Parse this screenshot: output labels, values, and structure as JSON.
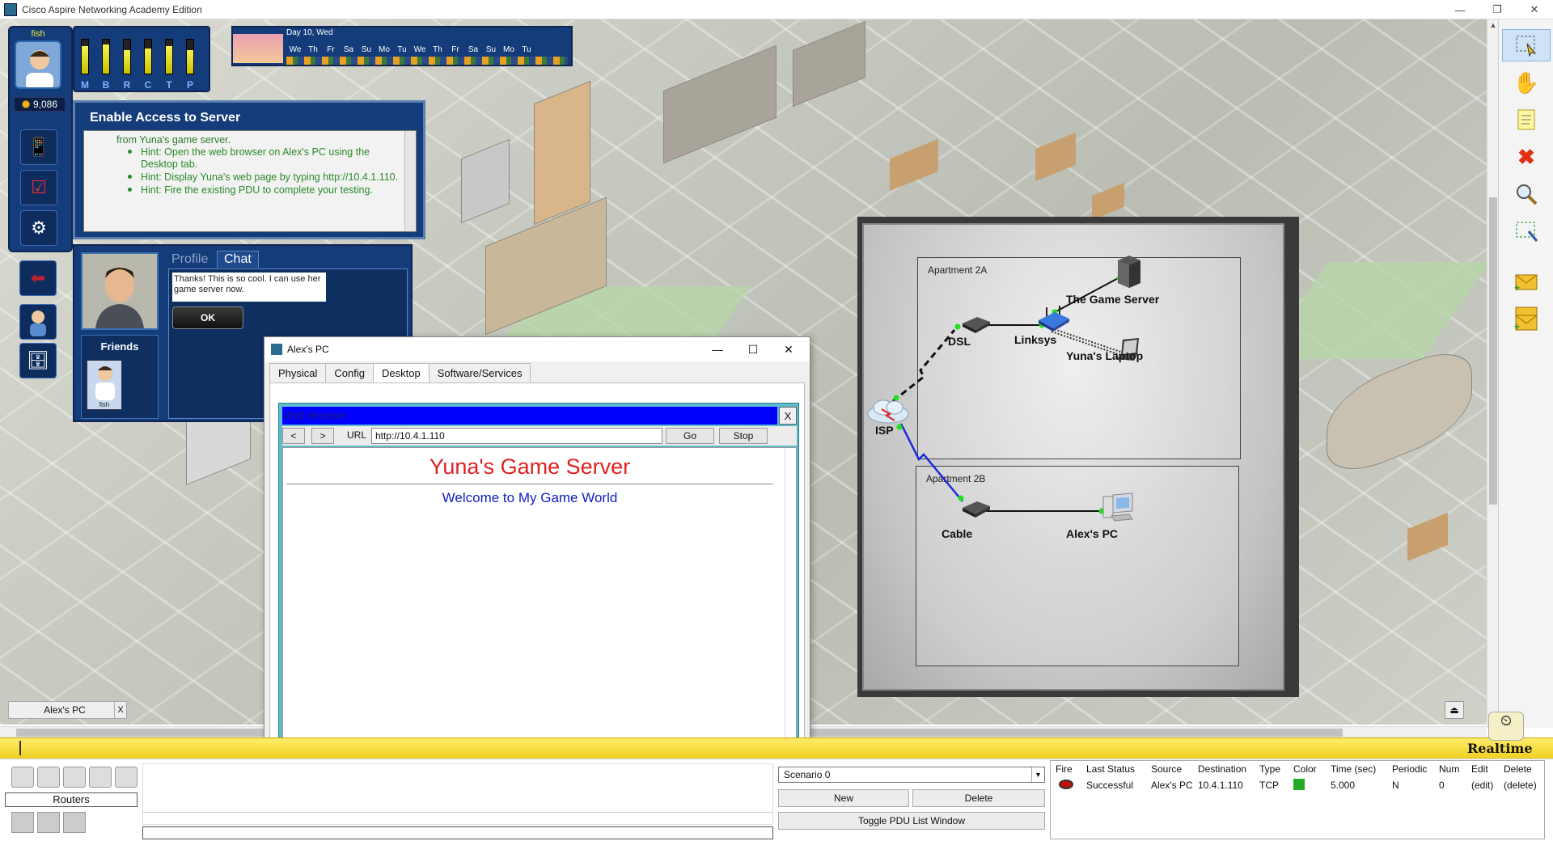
{
  "window": {
    "title": "Cisco Aspire Networking Academy Edition",
    "min": "—",
    "max": "❐",
    "close": "✕"
  },
  "player": {
    "name": "fish",
    "coins": "9,086",
    "meter_labels": [
      "M",
      "B",
      "R",
      "C",
      "T",
      "P"
    ],
    "meter_levels": [
      0.8,
      0.85,
      0.7,
      0.75,
      0.8,
      0.7
    ]
  },
  "calendar": {
    "day": "Day 10, Wed",
    "days": [
      "We",
      "Th",
      "Fr",
      "Sa",
      "Su",
      "Mo",
      "Tu",
      "We",
      "Th",
      "Fr",
      "Sa",
      "Su",
      "Mo",
      "Tu"
    ]
  },
  "task": {
    "title": "Enable Access to Server",
    "intro": "from Yuna's game server.",
    "hints": [
      "Hint: Open the web browser on Alex's PC using the Desktop tab.",
      "Hint: Display Yuna's web page by typing http://10.4.1.110.",
      "Hint: Fire the existing PDU to complete your testing."
    ]
  },
  "chat": {
    "tab_profile": "Profile",
    "tab_chat": "Chat",
    "message": "Thanks! This is so cool. I can use her game server now.",
    "ok": "OK",
    "friends_title": "Friends",
    "friend_name": "fish"
  },
  "network": {
    "apartment_a": "Apartment 2A",
    "apartment_b": "Apartment 2B",
    "devices": {
      "dsl": "DSL",
      "linksys": "Linksys",
      "game_server": "The Game Server",
      "laptop": "Yuna's Laptop",
      "isp": "ISP",
      "cable": "Cable",
      "alex_pc": "Alex's PC"
    }
  },
  "pc_window": {
    "title": "Alex's PC",
    "tabs": [
      "Physical",
      "Config",
      "Desktop",
      "Software/Services"
    ],
    "active_tab": "Desktop",
    "browser": {
      "title": "Web Browser",
      "close": "X",
      "back": "<",
      "forward": ">",
      "url_label": "URL",
      "url": "http://10.4.1.110",
      "go": "Go",
      "stop": "Stop",
      "page_title": "Yuna's Game Server",
      "page_subtitle": "Welcome to My Game World"
    }
  },
  "bottom": {
    "alex_chip": "Alex's PC",
    "alex_chip_close": "X",
    "realtime": "Realtime",
    "device_category": "Routers",
    "scenario": "Scenario 0",
    "new": "New",
    "delete": "Delete",
    "toggle_pdu": "Toggle PDU List Window",
    "pdu_headers": [
      "Fire",
      "Last Status",
      "Source",
      "Destination",
      "Type",
      "Color",
      "Time (sec)",
      "Periodic",
      "Num",
      "Edit",
      "Delete"
    ],
    "pdu_rows": [
      {
        "last_status": "Successful",
        "source": "Alex's PC",
        "destination": "10.4.1.110",
        "type": "TCP",
        "color": "#22aa22",
        "time": "5.000",
        "periodic": "N",
        "num": "0",
        "edit": "(edit)",
        "delete": "(delete)"
      }
    ]
  }
}
